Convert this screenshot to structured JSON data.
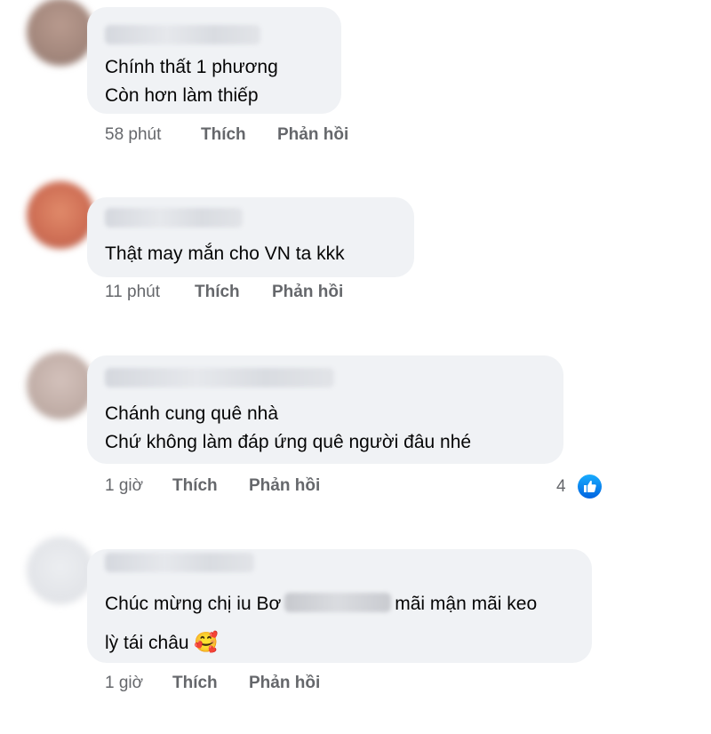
{
  "comments": [
    {
      "lines": [
        "Chính thất 1 phương",
        "Còn hơn làm thiếp"
      ],
      "time": "58 phút",
      "like_label": "Thích",
      "reply_label": "Phản hồi"
    },
    {
      "lines": [
        "Thật may mắn cho VN ta kkk"
      ],
      "time": "11 phút",
      "like_label": "Thích",
      "reply_label": "Phản hồi"
    },
    {
      "lines": [
        "Chánh cung quê nhà",
        "Chứ không làm đáp ứng quê người đâu nhé"
      ],
      "time": "1 giờ",
      "like_label": "Thích",
      "reply_label": "Phản hồi",
      "reaction_count": "4",
      "reaction_icon": "like-icon"
    },
    {
      "line1_before": "Chúc mừng chị iu Bơ",
      "line1_after": "mãi mận mãi keo",
      "line2": "lỳ tái châu",
      "emoji": "🥰",
      "time": "1 giờ",
      "like_label": "Thích",
      "reply_label": "Phản hồi"
    }
  ],
  "colors": {
    "bubble": "#f0f2f5",
    "meta_text": "#65676b",
    "like_blue": "#1877f2"
  }
}
